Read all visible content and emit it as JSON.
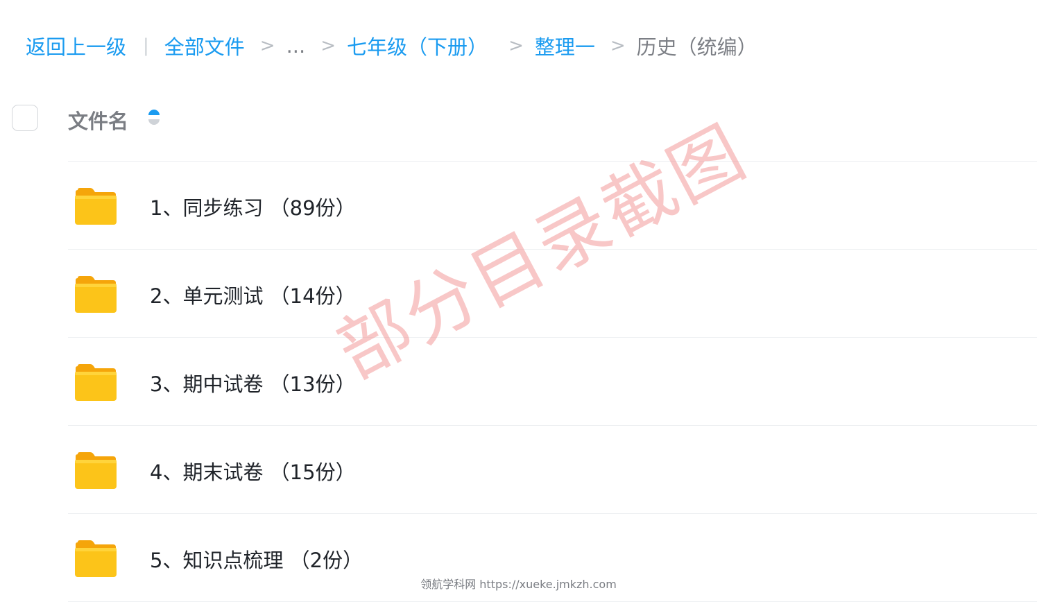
{
  "breadcrumb": {
    "back": "返回上一级",
    "bar": "|",
    "all_files": "全部文件",
    "sep": ">",
    "ellipsis": "...",
    "grade": "七年级（下册）",
    "collection": "整理一",
    "current": "历史（统编）"
  },
  "header": {
    "column_name": "文件名"
  },
  "files": [
    {
      "name": "1、同步练习 （89份）",
      "icon": "folder-icon"
    },
    {
      "name": "2、单元测试 （14份）",
      "icon": "folder-icon"
    },
    {
      "name": "3、期中试卷 （13份）",
      "icon": "folder-icon"
    },
    {
      "name": "4、期末试卷 （15份）",
      "icon": "folder-icon"
    },
    {
      "name": "5、知识点梳理 （2份）",
      "icon": "folder-icon"
    }
  ],
  "watermark": "部分目录截图",
  "footer": "领航学科网 https://xueke.jmkzh.com",
  "colors": {
    "link": "#1a9bf0",
    "folder": "#fcc419",
    "watermark": "#f08282"
  }
}
